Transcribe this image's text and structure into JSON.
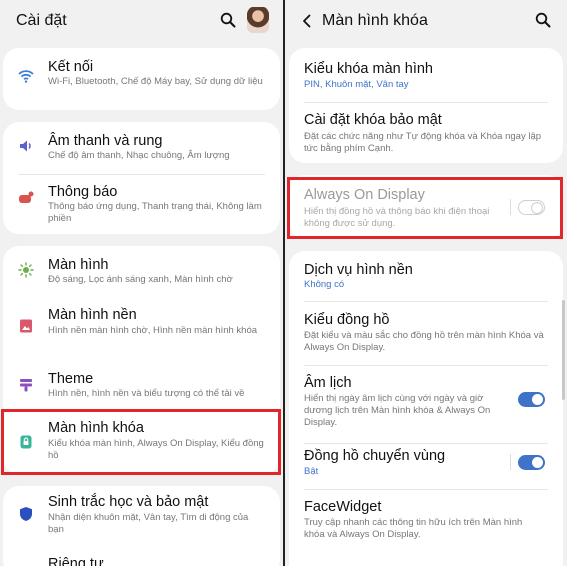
{
  "left": {
    "title": "Cài đặt",
    "items": [
      {
        "icon": "wifi-icon",
        "title": "Kết nối",
        "subtitle": "Wi-Fi, Bluetooth, Chế độ Máy bay, Sử dụng dữ liệu"
      },
      {
        "icon": "sound-icon",
        "title": "Âm thanh và rung",
        "subtitle": "Chế độ âm thanh, Nhạc chuông, Âm lượng"
      },
      {
        "icon": "notification-icon",
        "title": "Thông báo",
        "subtitle": "Thông báo ứng dụng, Thanh trạng thái, Không làm phiền"
      },
      {
        "icon": "brightness-icon",
        "title": "Màn hình",
        "subtitle": "Độ sáng, Lọc ánh sáng xanh, Màn hình chờ"
      },
      {
        "icon": "wallpaper-icon",
        "title": "Màn hình nền",
        "subtitle": "Hình nền màn hình chờ, Hình nền màn hình khóa"
      },
      {
        "icon": "theme-icon",
        "title": "Theme",
        "subtitle": "Hình nền, hình nền và biểu tượng có thể tải về"
      },
      {
        "icon": "lock-icon",
        "title": "Màn hình khóa",
        "subtitle": "Kiểu khóa màn hình, Always On Display, Kiểu đồng hồ"
      },
      {
        "icon": "shield-icon",
        "title": "Sinh trắc học và bảo mật",
        "subtitle": "Nhận diện khuôn mặt, Vân tay, Tìm di động của bạn"
      },
      {
        "icon": "privacy-icon",
        "title": "Riêng tư",
        "subtitle": ""
      }
    ]
  },
  "right": {
    "title": "Màn hình khóa",
    "items": [
      {
        "title": "Kiểu khóa màn hình",
        "subtitle": "PIN, Khuôn mặt, Vân tay",
        "subtitle_style": "blue"
      },
      {
        "title": "Cài đặt khóa bảo mật",
        "subtitle": "Đặt các chức năng như Tự động khóa và Khóa ngay lập tức bằng phím Cạnh."
      },
      {
        "title": "Always On Display",
        "subtitle": "Hiển thị đồng hồ và thông báo khi điện thoại không được sử dụng.",
        "toggle": "off"
      },
      {
        "title": "Dịch vụ hình nền",
        "subtitle": "Không có",
        "subtitle_style": "blue"
      },
      {
        "title": "Kiểu đồng hồ",
        "subtitle": "Đặt kiểu và màu sắc cho đồng hồ trên màn hình Khóa và Always On Display."
      },
      {
        "title": "Âm lịch",
        "subtitle": "Hiển thị ngày âm lịch cùng với ngày và giờ dương lịch trên Màn hình khóa & Always On Display.",
        "toggle": "on"
      },
      {
        "title": "Đồng hồ chuyển vùng",
        "subtitle": "Bật",
        "subtitle_style": "blue",
        "toggle": "on"
      },
      {
        "title": "FaceWidget",
        "subtitle": "Truy cập nhanh các thông tin hữu ích trên Màn hình khóa và Always On Display."
      }
    ]
  },
  "colors": {
    "highlight": "#e0262b",
    "accent": "#3e73c7",
    "background": "#f1f1f1"
  }
}
